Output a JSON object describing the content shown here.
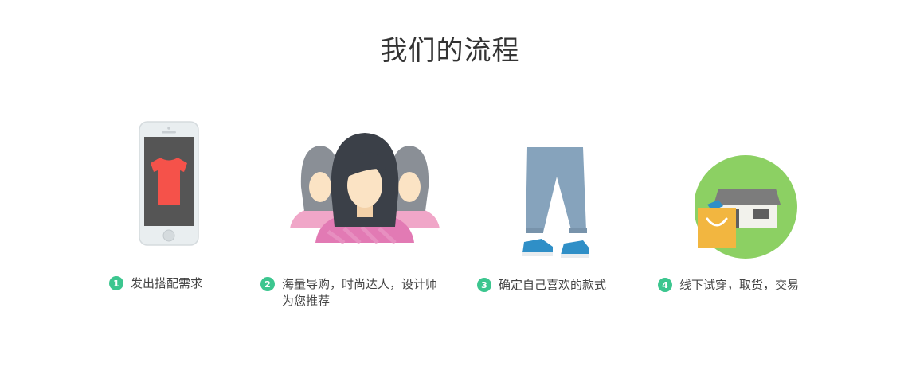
{
  "section": {
    "title": "我们的流程"
  },
  "colors": {
    "accent": "#3cc68f",
    "shirt": "#f5524a",
    "pants": "#86a3bc",
    "shoes": "#2f8fc7",
    "store_circle": "#8cd063",
    "bag": "#f2b640",
    "pink": "#f0a6c8"
  },
  "steps": [
    {
      "num": "1",
      "text": "发出搭配需求",
      "icon": "phone-shirt-icon"
    },
    {
      "num": "2",
      "text": "海量导购，时尚达人，设计师为您推荐",
      "icon": "stylists-icon"
    },
    {
      "num": "3",
      "text": "确定自己喜欢的款式",
      "icon": "pants-shoes-icon"
    },
    {
      "num": "4",
      "text": "线下试穿，取货，交易",
      "icon": "store-bag-icon"
    }
  ]
}
